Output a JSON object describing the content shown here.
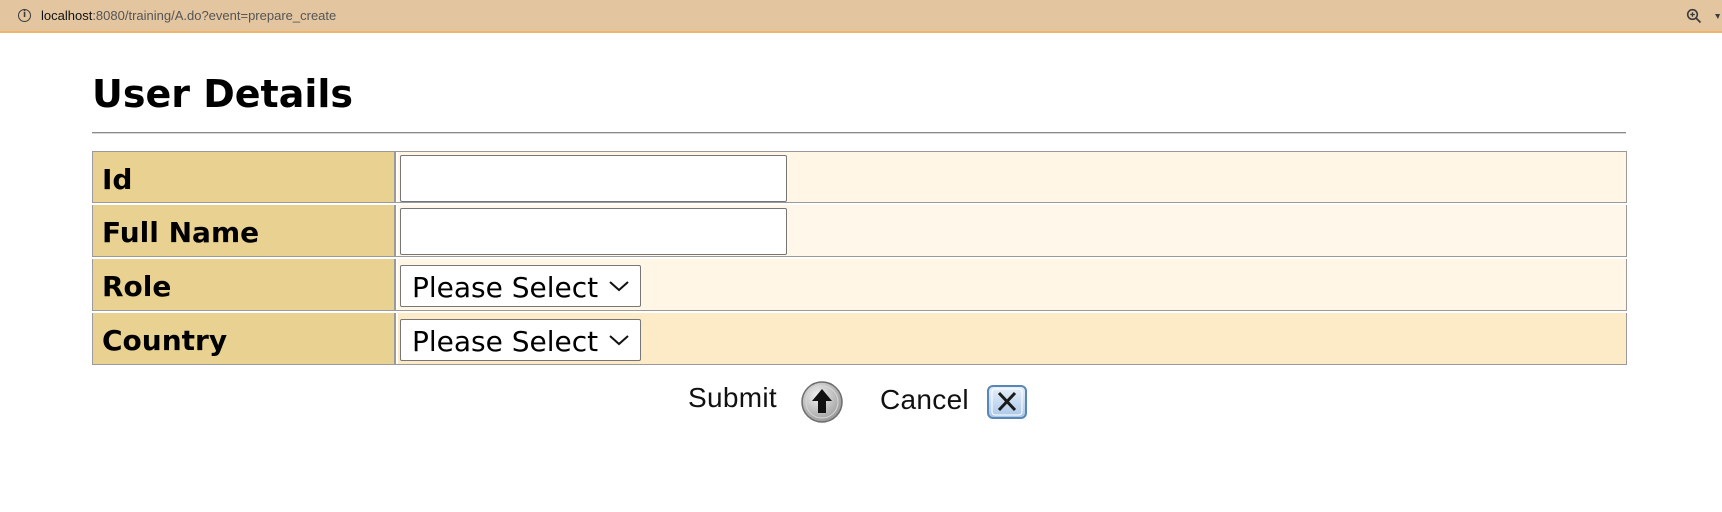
{
  "browser": {
    "url_host": "localhost",
    "url_rest": ":8080/training/A.do?event=prepare_create",
    "info_icon": "info-icon",
    "zoom_icon": "zoom-icon"
  },
  "page": {
    "title": "User Details"
  },
  "form": {
    "rows": [
      {
        "label": "Id",
        "value": "",
        "type": "text"
      },
      {
        "label": "Full Name",
        "value": "",
        "type": "text"
      },
      {
        "label": "Role",
        "selected": "Please Select",
        "type": "select"
      },
      {
        "label": "Country",
        "selected": "Please Select",
        "type": "select"
      }
    ]
  },
  "actions": {
    "submit_label": "Submit",
    "cancel_label": "Cancel",
    "submit_icon": "arrow-up-circle-icon",
    "cancel_icon": "close-box-icon"
  },
  "colors": {
    "browser_bar": "#e3c5a0",
    "label_cell": "#e8d191",
    "value_cell_light": "#fff6e6",
    "value_cell_tan": "#fdebc8"
  }
}
